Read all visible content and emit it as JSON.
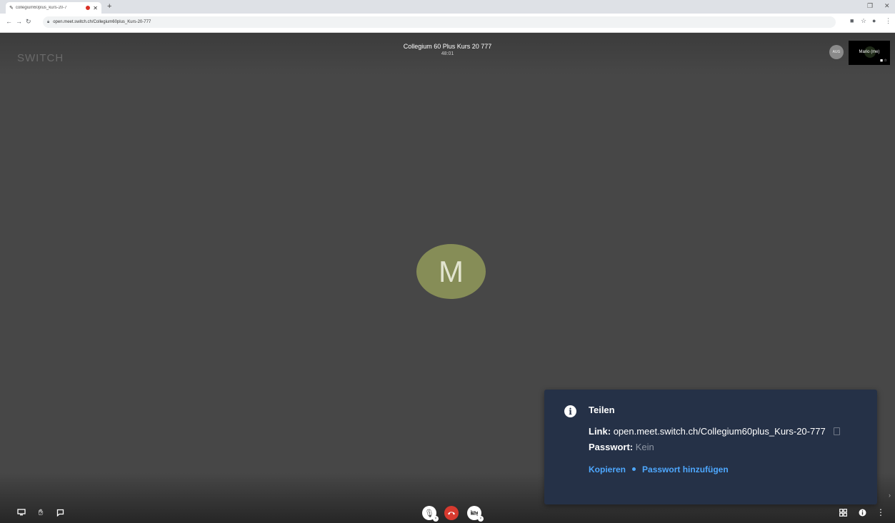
{
  "browser": {
    "tab_title": "collegium60plus_kurs-20-7",
    "new_tab_label": "+",
    "url": "open.meet.switch.ch/Collegium60plus_Kurs-20-777"
  },
  "meeting": {
    "brand": "SWITCH",
    "title": "Collegium 60 Plus Kurs 20 777",
    "timer": "48:01",
    "participant_initial": "M",
    "mini_avatar_label": "AUG",
    "self_name": "Mario (me)"
  },
  "share_dialog": {
    "title": "Teilen",
    "link_label": "Link:",
    "link_value": "open.meet.switch.ch/Collegium60plus_Kurs-20-777",
    "password_label": "Passwort:",
    "password_value": "Kein",
    "copy_action": "Kopieren",
    "add_password_action": "Passwort hinzufügen"
  },
  "colors": {
    "background": "#474747",
    "avatar": "#868d57",
    "dialog": "#253147",
    "link": "#4ea8ff",
    "hangup": "#d83a2f"
  },
  "icons": {
    "screen_share": "screen-share-icon",
    "raise_hand": "raise-hand-icon",
    "chat": "chat-icon",
    "microphone": "microphone-icon",
    "hangup": "hangup-icon",
    "camera_off": "camera-off-icon",
    "tile_view": "tile-view-icon",
    "info": "info-icon",
    "more": "more-icon"
  }
}
